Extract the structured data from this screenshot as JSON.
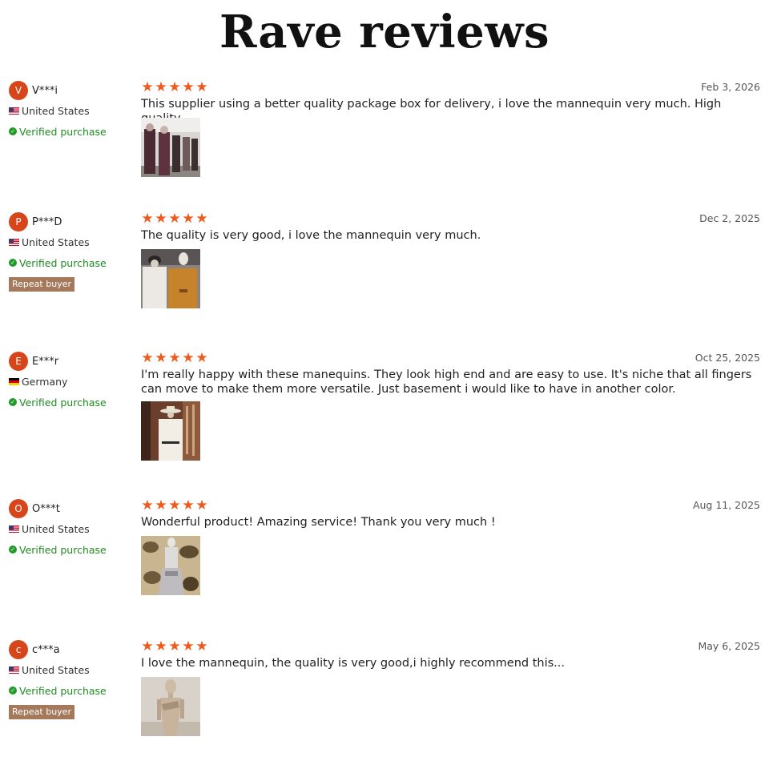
{
  "page": {
    "title": "Rave reviews"
  },
  "reviews": [
    {
      "initial": "V",
      "name": "V***i",
      "country": "United States",
      "flag": "us-flag-icon",
      "verified": "Verified purchase",
      "rating": 5,
      "date": "Feb 3, 2026",
      "text": "This supplier using a better quality package box for delivery, i love the mannequin very much. High quality"
    },
    {
      "initial": "P",
      "name": "P***D",
      "country": "United States",
      "flag": "us-flag-icon",
      "verified": "Verified purchase",
      "badge": "Repeat buyer",
      "rating": 5,
      "date": "Dec 2, 2025",
      "text": "The quality is very good, i love the mannequin very much."
    },
    {
      "initial": "E",
      "name": "E***r",
      "country": "Germany",
      "flag": "de-flag-icon",
      "verified": "Verified purchase",
      "rating": 5,
      "date": "Oct 25, 2025",
      "text": "I'm really happy with these manequins. They look high end and are easy to use. It's niche that all fingers can move to make them more versatile. Just basement i would like to have in another color."
    },
    {
      "initial": "O",
      "name": "O***t",
      "country": "United States",
      "flag": "us-flag-icon",
      "verified": "Verified purchase",
      "rating": 5,
      "date": "Aug 11, 2025",
      "text": "Wonderful product! Amazing service! Thank you very much !"
    },
    {
      "initial": "c",
      "name": "c***a",
      "country": "United States",
      "flag": "us-flag-icon",
      "verified": "Verified purchase",
      "badge": "Repeat buyer",
      "rating": 5,
      "date": "May 6, 2025",
      "text": "I love the mannequin, the quality is very good,i highly recommend this..."
    }
  ],
  "colors": {
    "star": "#ee5a1c",
    "avatar": "#d7461b",
    "verified": "#1f8a22",
    "badge": "#a57a5c"
  }
}
